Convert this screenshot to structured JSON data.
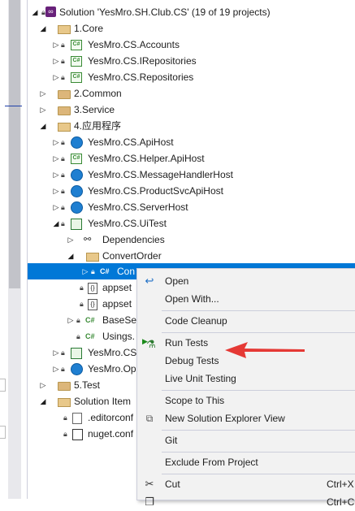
{
  "solution": {
    "label": "Solution 'YesMro.SH.Club.CS' (19 of 19 projects)"
  },
  "tree": {
    "core": "1.Core",
    "accounts": "YesMro.CS.Accounts",
    "irepositories": "YesMro.CS.IRepositories",
    "repositories": "YesMro.CS.Repositories",
    "common": "2.Common",
    "service": "3.Service",
    "app": "4.应用程序",
    "apihost": "YesMro.CS.ApiHost",
    "helperapihost": "YesMro.CS.Helper.ApiHost",
    "messagehandlerhost": "YesMro.CS.MessageHandlerHost",
    "productsvcapihost": "YesMro.CS.ProductSvcApiHost",
    "serverhost": "YesMro.CS.ServerHost",
    "uitest": "YesMro.CS.UiTest",
    "dependencies": "Dependencies",
    "convertorder": "ConvertOrder",
    "selected_file": "Con",
    "appsettings1": "appset",
    "appsettings2": "appset",
    "basese": "BaseSe",
    "usings": "Usings.",
    "yesmro_cs": "YesMro.CS",
    "yesmro_op": "YesMro.Op",
    "test": "5.Test",
    "solution_items": "Solution Item",
    "editorconfig": ".editorconf",
    "nugetconfig": "nuget.conf"
  },
  "context_menu": {
    "open": "Open",
    "open_with": "Open With...",
    "code_cleanup": "Code Cleanup",
    "run_tests": "Run Tests",
    "debug_tests": "Debug Tests",
    "live_unit_testing": "Live Unit Testing",
    "scope_to_this": "Scope to This",
    "new_solution_explorer_view": "New Solution Explorer View",
    "git": "Git",
    "exclude_from_project": "Exclude From Project",
    "cut": "Cut",
    "cut_shortcut": "Ctrl+X",
    "copy_shortcut": "Ctrl+C"
  },
  "icons": {
    "open": "open-arrow-icon",
    "run_tests": "run-tests-flask-icon",
    "new_view": "new-window-icon",
    "cut": "scissors-icon"
  },
  "colors": {
    "selection": "#0078d7",
    "annotation_arrow": "#e53935"
  }
}
